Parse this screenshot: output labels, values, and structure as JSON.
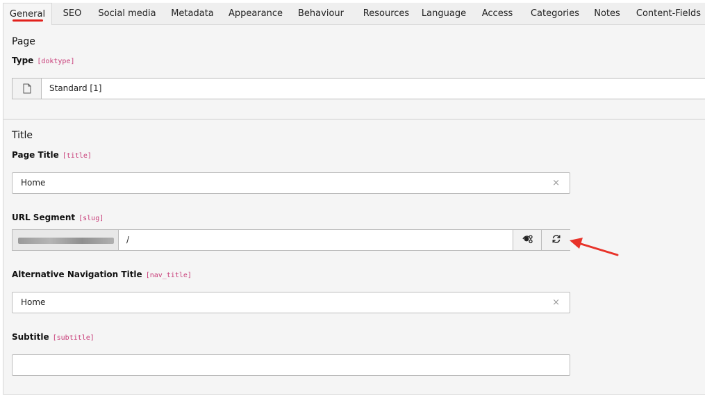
{
  "tabs": [
    {
      "label": "General",
      "active": true
    },
    {
      "label": "SEO"
    },
    {
      "label": "Social media"
    },
    {
      "label": "Metadata"
    },
    {
      "label": "Appearance"
    },
    {
      "label": "Behaviour"
    },
    {
      "label": "Resources"
    },
    {
      "label": "Language"
    },
    {
      "label": "Access"
    },
    {
      "label": "Categories"
    },
    {
      "label": "Notes"
    },
    {
      "label": "Content-Fields"
    }
  ],
  "page_section": {
    "heading": "Page",
    "type_label": "Type",
    "type_field": "[doktype]",
    "type_value": "Standard [1]",
    "type_icon": "document-icon"
  },
  "title_section": {
    "heading": "Title",
    "page_title": {
      "label": "Page Title",
      "field": "[title]",
      "value": "Home",
      "clear": "×"
    },
    "url_segment": {
      "label": "URL Segment",
      "field": "[slug]",
      "value": "/",
      "buttons": [
        "toggle-manual-edit-icon",
        "recalculate-slug-icon"
      ]
    },
    "nav_title": {
      "label": "Alternative Navigation Title",
      "field": "[nav_title]",
      "value": "Home",
      "clear": "×"
    },
    "subtitle": {
      "label": "Subtitle",
      "field": "[subtitle]",
      "value": ""
    }
  },
  "colors": {
    "accent": "#e2211c",
    "field_code": "#c83c78",
    "annotation_arrow": "#e8332a"
  }
}
